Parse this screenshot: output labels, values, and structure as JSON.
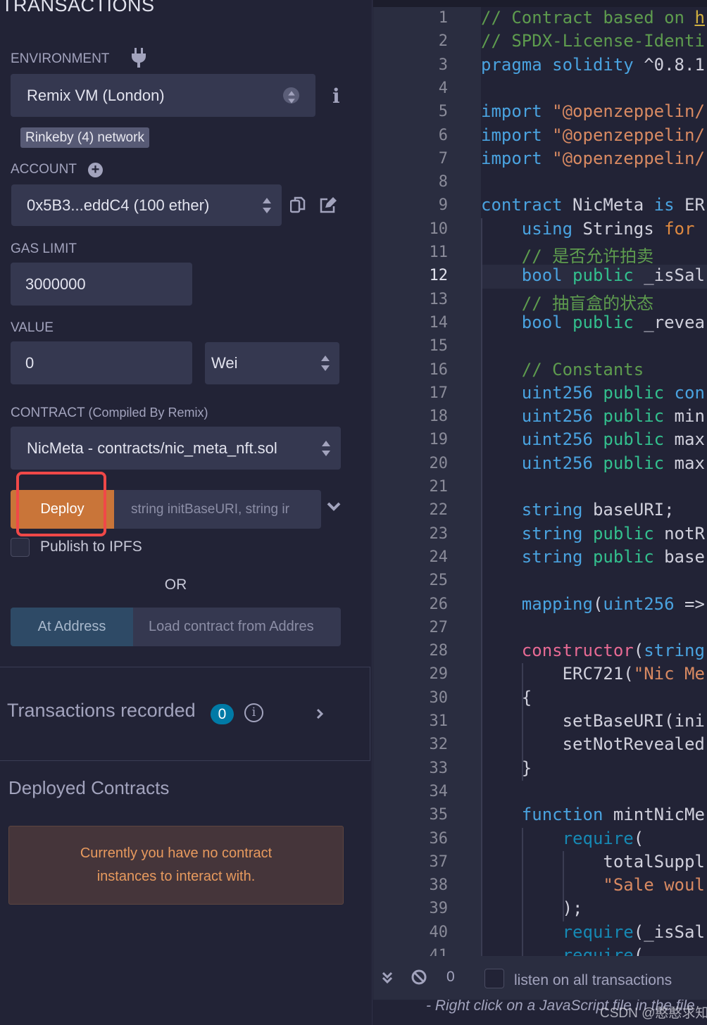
{
  "left_panel": {
    "section_title": "TRANSACTIONS",
    "environment": {
      "label": "ENVIRONMENT",
      "icon": "plug-icon",
      "value": "Remix VM (London)",
      "network_badge": "Rinkeby (4) network"
    },
    "account": {
      "label": "ACCOUNT",
      "value": "0x5B3...eddC4 (100 ether)"
    },
    "gas_limit": {
      "label": "GAS LIMIT",
      "value": "3000000"
    },
    "value": {
      "label": "VALUE",
      "amount": "0",
      "unit": "Wei"
    },
    "contract": {
      "label": "CONTRACT",
      "sublabel": "(Compiled By Remix)",
      "value": "NicMeta - contracts/nic_meta_nft.sol"
    },
    "deploy": {
      "button": "Deploy",
      "params_placeholder": "string initBaseURI, string ir"
    },
    "publish_ipfs": {
      "label": "Publish to IPFS",
      "checked": false
    },
    "or_text": "OR",
    "at_address": {
      "button": "At Address",
      "placeholder": "Load contract from Addres"
    },
    "transactions_recorded": {
      "label": "Transactions recorded",
      "count": "0"
    },
    "deployed_contracts": {
      "title": "Deployed Contracts",
      "empty_message_line1": "Currently you have no contract",
      "empty_message_line2": "instances to interact with."
    }
  },
  "editor": {
    "active_line": 12,
    "lines": [
      {
        "n": "1",
        "indent": 0,
        "tokens": [
          [
            "// Contract based on ",
            "comment"
          ],
          [
            "h",
            "link"
          ]
        ]
      },
      {
        "n": "2",
        "indent": 0,
        "tokens": [
          [
            "// SPDX-License-Identi",
            "comment"
          ]
        ]
      },
      {
        "n": "3",
        "indent": 0,
        "tokens": [
          [
            "pragma solidity ",
            "kw"
          ],
          [
            "^0.8.1",
            "plain"
          ]
        ]
      },
      {
        "n": "4",
        "indent": 0,
        "tokens": []
      },
      {
        "n": "5",
        "indent": 0,
        "tokens": [
          [
            "import ",
            "kw"
          ],
          [
            "\"@openzeppelin/",
            "str"
          ]
        ]
      },
      {
        "n": "6",
        "indent": 0,
        "tokens": [
          [
            "import ",
            "kw"
          ],
          [
            "\"@openzeppelin/",
            "str"
          ]
        ]
      },
      {
        "n": "7",
        "indent": 0,
        "tokens": [
          [
            "import ",
            "kw"
          ],
          [
            "\"@openzeppelin/",
            "str"
          ]
        ]
      },
      {
        "n": "8",
        "indent": 0,
        "tokens": []
      },
      {
        "n": "9",
        "indent": 0,
        "tokens": [
          [
            "contract ",
            "kw"
          ],
          [
            "NicMeta ",
            "plain"
          ],
          [
            "is ",
            "kw"
          ],
          [
            "ER",
            "plain"
          ]
        ]
      },
      {
        "n": "10",
        "indent": 1,
        "tokens": [
          [
            "using ",
            "kw"
          ],
          [
            "Strings ",
            "plain"
          ],
          [
            "for",
            "for"
          ]
        ]
      },
      {
        "n": "11",
        "indent": 1,
        "tokens": [
          [
            "// 是否允许拍卖",
            "comment"
          ]
        ]
      },
      {
        "n": "12",
        "indent": 1,
        "tokens": [
          [
            "bool ",
            "kw"
          ],
          [
            "public ",
            "pub"
          ],
          [
            "_isSal",
            "plain"
          ]
        ]
      },
      {
        "n": "13",
        "indent": 1,
        "tokens": [
          [
            "// 抽盲盒的状态",
            "comment"
          ]
        ]
      },
      {
        "n": "14",
        "indent": 1,
        "tokens": [
          [
            "bool ",
            "kw"
          ],
          [
            "public ",
            "pub"
          ],
          [
            "_revea",
            "plain"
          ]
        ]
      },
      {
        "n": "15",
        "indent": 1,
        "tokens": []
      },
      {
        "n": "16",
        "indent": 1,
        "tokens": [
          [
            "// Constants",
            "comment"
          ]
        ]
      },
      {
        "n": "17",
        "indent": 1,
        "tokens": [
          [
            "uint256 ",
            "kw"
          ],
          [
            "public ",
            "pub"
          ],
          [
            "con",
            "kw"
          ]
        ]
      },
      {
        "n": "18",
        "indent": 1,
        "tokens": [
          [
            "uint256 ",
            "kw"
          ],
          [
            "public ",
            "pub"
          ],
          [
            "min",
            "plain"
          ]
        ]
      },
      {
        "n": "19",
        "indent": 1,
        "tokens": [
          [
            "uint256 ",
            "kw"
          ],
          [
            "public ",
            "pub"
          ],
          [
            "max",
            "plain"
          ]
        ]
      },
      {
        "n": "20",
        "indent": 1,
        "tokens": [
          [
            "uint256 ",
            "kw"
          ],
          [
            "public ",
            "pub"
          ],
          [
            "max",
            "plain"
          ]
        ]
      },
      {
        "n": "21",
        "indent": 1,
        "tokens": []
      },
      {
        "n": "22",
        "indent": 1,
        "tokens": [
          [
            "string ",
            "kw"
          ],
          [
            "baseURI;",
            "plain"
          ]
        ]
      },
      {
        "n": "23",
        "indent": 1,
        "tokens": [
          [
            "string ",
            "kw"
          ],
          [
            "public ",
            "pub"
          ],
          [
            "notR",
            "plain"
          ]
        ]
      },
      {
        "n": "24",
        "indent": 1,
        "tokens": [
          [
            "string ",
            "kw"
          ],
          [
            "public ",
            "pub"
          ],
          [
            "base",
            "plain"
          ]
        ]
      },
      {
        "n": "25",
        "indent": 1,
        "tokens": []
      },
      {
        "n": "26",
        "indent": 1,
        "tokens": [
          [
            "mapping",
            "kw"
          ],
          [
            "(",
            "plain"
          ],
          [
            "uint256 ",
            "kw"
          ],
          [
            "=>",
            "plain"
          ]
        ]
      },
      {
        "n": "27",
        "indent": 1,
        "tokens": []
      },
      {
        "n": "28",
        "indent": 1,
        "tokens": [
          [
            "constructor",
            "ctor"
          ],
          [
            "(",
            "plain"
          ],
          [
            "string",
            "kw"
          ]
        ]
      },
      {
        "n": "29",
        "indent": 2,
        "tokens": [
          [
            "ERC721(",
            "plain"
          ],
          [
            "\"Nic Me",
            "str"
          ]
        ]
      },
      {
        "n": "30",
        "indent": 1,
        "tokens": [
          [
            "{",
            "plain"
          ]
        ]
      },
      {
        "n": "31",
        "indent": 2,
        "tokens": [
          [
            "setBaseURI(ini",
            "plain"
          ]
        ]
      },
      {
        "n": "32",
        "indent": 2,
        "tokens": [
          [
            "setNotRevealed",
            "plain"
          ]
        ]
      },
      {
        "n": "33",
        "indent": 1,
        "tokens": [
          [
            "}",
            "plain"
          ]
        ]
      },
      {
        "n": "34",
        "indent": 1,
        "tokens": []
      },
      {
        "n": "35",
        "indent": 1,
        "tokens": [
          [
            "function ",
            "kw"
          ],
          [
            "mintNicMe",
            "plain"
          ]
        ]
      },
      {
        "n": "36",
        "indent": 2,
        "tokens": [
          [
            "require",
            "req"
          ],
          [
            "(",
            "plain"
          ]
        ]
      },
      {
        "n": "37",
        "indent": 3,
        "tokens": [
          [
            "totalSuppl",
            "plain"
          ]
        ]
      },
      {
        "n": "38",
        "indent": 3,
        "tokens": [
          [
            "\"Sale woul",
            "str"
          ]
        ]
      },
      {
        "n": "39",
        "indent": 2,
        "tokens": [
          [
            ");",
            "plain"
          ]
        ]
      },
      {
        "n": "40",
        "indent": 2,
        "tokens": [
          [
            "require",
            "req"
          ],
          [
            "(_isSal",
            "plain"
          ]
        ]
      },
      {
        "n": "41",
        "indent": 2,
        "tokens": [
          [
            "require",
            "req"
          ],
          [
            "(",
            "plain"
          ]
        ]
      }
    ]
  },
  "terminal": {
    "pending_count": "0",
    "listen_label": "listen on all transactions",
    "listen_checked": false,
    "hint_text": "- Right click on a JavaScript file in the file"
  },
  "watermark": "CSDN @憨憨求知",
  "colors": {
    "deploy": "#c97539",
    "at_address": "#2e4a66",
    "badge": "#007aa6",
    "alert_text": "#e89a5e",
    "annotation": "#f04848"
  }
}
